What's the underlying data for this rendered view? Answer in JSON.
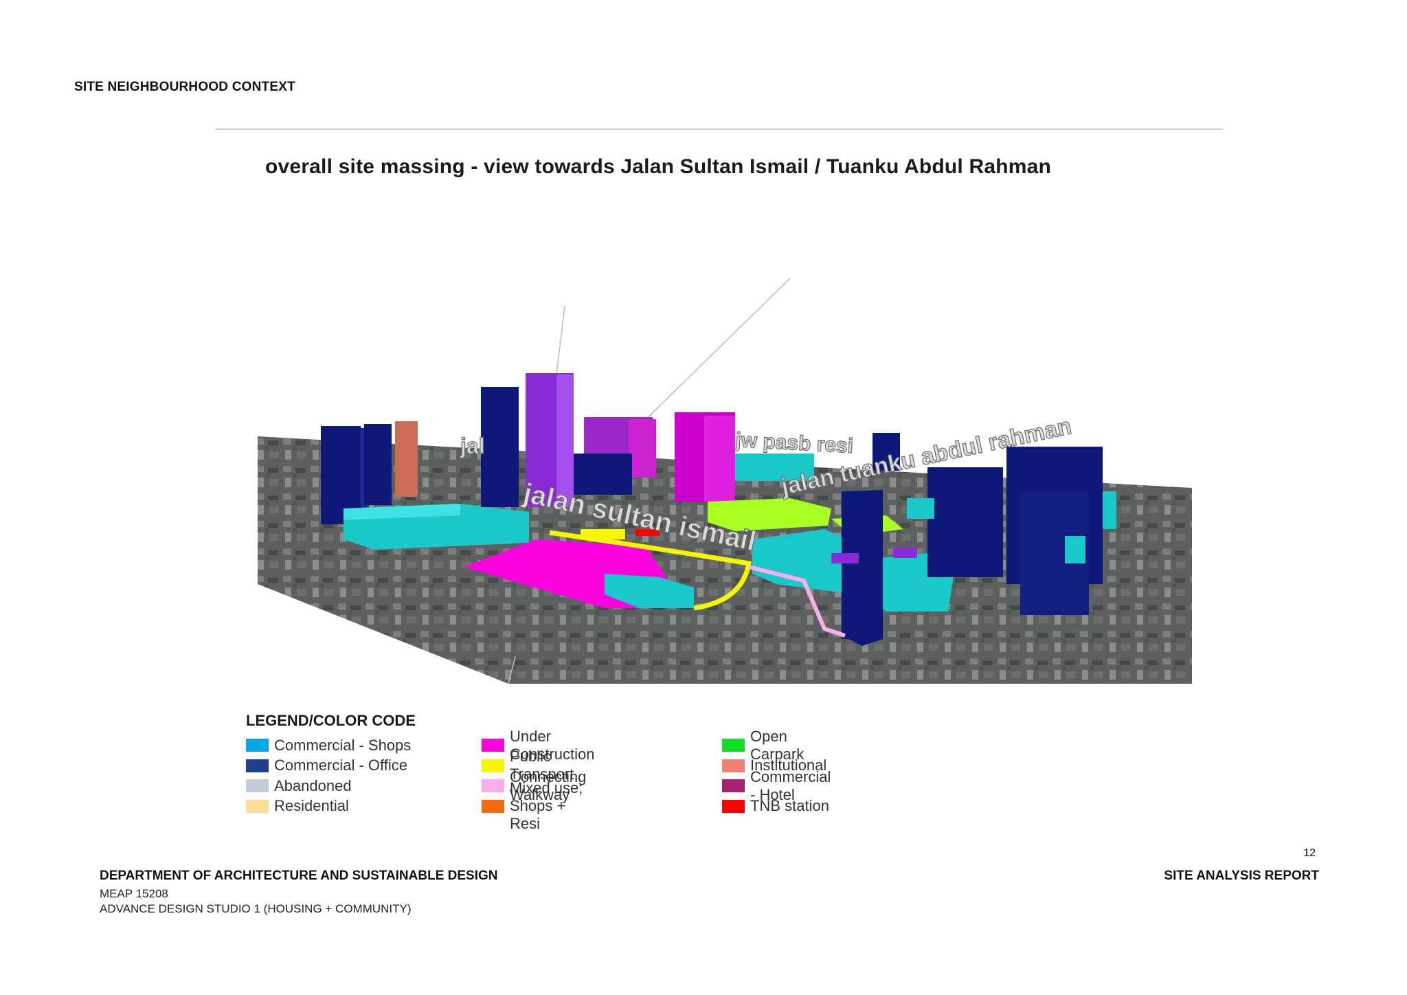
{
  "header": {
    "section_title": "SITE NEIGHBOURHOOD CONTEXT"
  },
  "figure": {
    "title": "overall site massing - view towards Jalan Sultan Ismail / Tuanku Abdul Rahman",
    "street_labels": [
      "jalan sultan ismail",
      "jalan tuanku abdul rahman",
      "jal",
      "jw pasb resi"
    ]
  },
  "legend": {
    "title": "LEGEND/COLOR CODE",
    "columns": [
      [
        {
          "label": "Commercial - Shops",
          "color": "#00a8e8"
        },
        {
          "label": "Commercial - Office",
          "color": "#1f3f8f"
        },
        {
          "label": "Abandoned",
          "color": "#c2ccd6"
        },
        {
          "label": "Residential",
          "color": "#fddc96"
        }
      ],
      [
        {
          "label": "Under Construction",
          "color": "#ff00e0"
        },
        {
          "label": "Public Transport",
          "color": "#f6f600"
        },
        {
          "label": "Connecting Walkway",
          "color": "#fbaee8"
        },
        {
          "label": "Mixed use; Shops + Resi",
          "color": "#f36a10"
        }
      ],
      [
        {
          "label": "Open Carpark",
          "color": "#10e020"
        },
        {
          "label": "Institutional",
          "color": "#f08070"
        },
        {
          "label": "Commercial - Hotel",
          "color": "#a8206e"
        },
        {
          "label": "TNB station",
          "color": "#ff0000"
        }
      ]
    ]
  },
  "footer": {
    "page_number": "12",
    "department": "DEPARTMENT OF ARCHITECTURE AND SUSTAINABLE DESIGN",
    "course_code": "MEAP 15208",
    "course_name": "ADVANCE DESIGN STUDIO 1 (HOUSING + COMMUNITY)",
    "report_title": "SITE ANALYSIS REPORT"
  }
}
